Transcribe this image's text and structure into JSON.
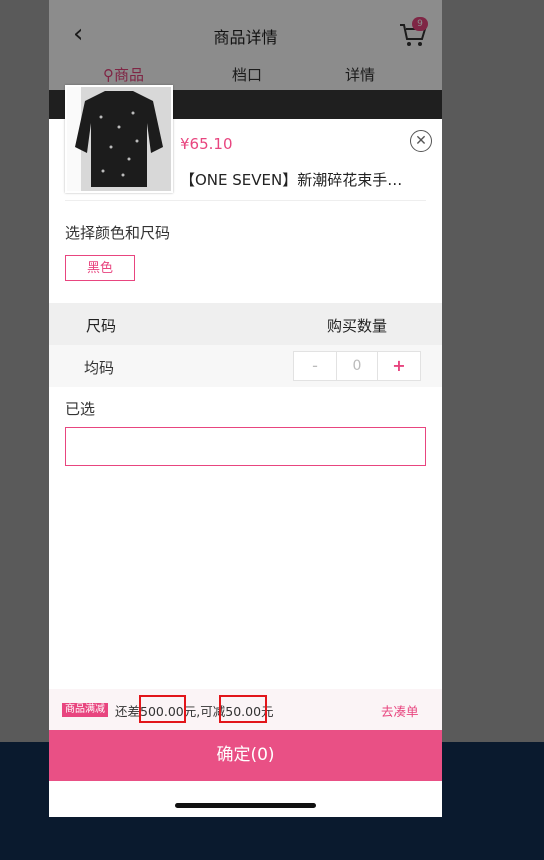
{
  "header": {
    "title": "商品详情",
    "cart_count": "9"
  },
  "tabs": [
    {
      "label": "商品",
      "active": true
    },
    {
      "label": "档口",
      "active": false
    },
    {
      "label": "详情",
      "active": false
    }
  ],
  "product": {
    "price": "¥65.10",
    "title": "【ONE SEVEN】新潮碎花束手…"
  },
  "options": {
    "section_title": "选择颜色和尺码",
    "colors": [
      "黑色"
    ],
    "table_headers": {
      "size": "尺码",
      "quantity": "购买数量"
    },
    "rows": [
      {
        "size": "均码",
        "quantity": "0",
        "minus": "-",
        "plus": "+"
      }
    ]
  },
  "selected": {
    "label": "已选",
    "value": ""
  },
  "promo": {
    "tag": "商品满减",
    "text_prefix": "还差",
    "amount_needed": "500.00",
    "text_mid": "元,可减",
    "discount": "50.00",
    "text_suffix": "元",
    "link": "去凑单"
  },
  "confirm_button": "确定(0)",
  "colors": {
    "accent": "#e8457f",
    "highlight_box": "#e2151a"
  }
}
